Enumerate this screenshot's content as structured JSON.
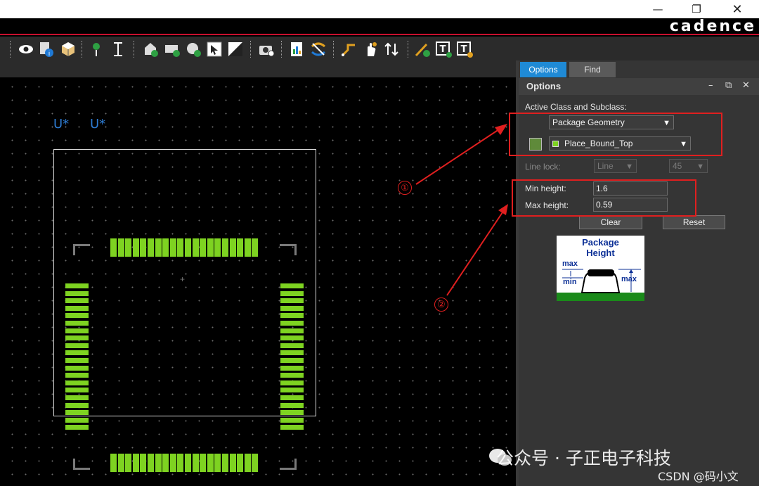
{
  "window": {
    "brand": "cadence",
    "controls": {
      "minimize": "—",
      "maximize": "❐",
      "close": "✕"
    }
  },
  "toolbar": {
    "icons": [
      "visibility-icon",
      "info-icon",
      "3d-viewer-icon",
      "add-pin-icon",
      "text-cursor-icon",
      "add-shape-icon",
      "add-rect-icon",
      "add-circle-icon",
      "select-icon",
      "fill-icon",
      "camera-settings-icon",
      "report-icon",
      "swap-icon",
      "route-icon",
      "move-icon",
      "flip-icon",
      "add-line-icon",
      "add-text-icon",
      "edit-text-icon"
    ]
  },
  "canvas": {
    "refdes": [
      "U*",
      "U*"
    ],
    "pin_color": "#7ed321",
    "top_pin_count": 20,
    "side_pin_count": 20
  },
  "panel": {
    "tabs": [
      {
        "label": "Options",
        "active": true
      },
      {
        "label": "Find",
        "active": false
      }
    ],
    "title": "Options",
    "header_icons": {
      "minimize": "–",
      "float": "⧉",
      "close": "✕"
    },
    "active_class_label": "Active Class and Subclass:",
    "class_value": "Package Geometry",
    "subclass_value": "Place_Bound_Top",
    "line_lock_label": "Line lock:",
    "line_lock_value": "Line",
    "angle_value": "45",
    "min_height_label": "Min height:",
    "min_height_value": "1.6",
    "max_height_label": "Max height:",
    "max_height_value": "0.59",
    "clear_button": "Clear",
    "reset_button": "Reset",
    "diagram": {
      "title_line1": "Package",
      "title_line2": "Height",
      "max_label": "max",
      "min_label": "min",
      "right_max_label": "max"
    }
  },
  "annotations": {
    "callout1": "①",
    "callout2": "②",
    "color": "#e01f1f"
  },
  "watermark": {
    "text": "公众号 · 子正电子科技",
    "csdn": "CSDN @码小文"
  }
}
